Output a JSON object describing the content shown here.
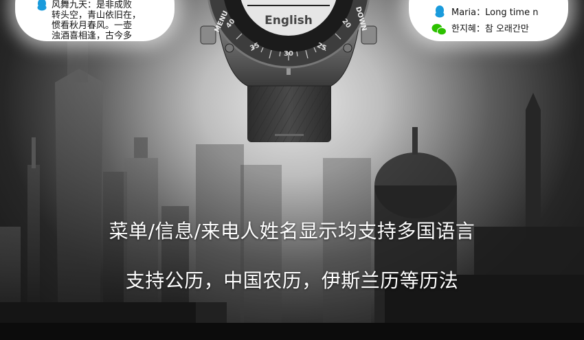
{
  "left_bubble": {
    "lines": [
      "风舞九天：是非成败",
      "转头空，青山依旧在，",
      "惯看秋月春风。一壶",
      "浊酒喜相逢，古今多"
    ]
  },
  "right_bubble": {
    "messages": [
      {
        "icon": "qq-penguin-icon",
        "text": "Maria：Long time n"
      },
      {
        "icon": "wechat-icon",
        "text": "한지혜：참 오래간만"
      }
    ]
  },
  "watch": {
    "screen_text": "English",
    "bezel_numbers": [
      "40",
      "35",
      "30",
      "25",
      "20"
    ],
    "left_button_label": "MENU",
    "right_button_label": "DOWN"
  },
  "captions": {
    "line1": "菜单/信息/来电人姓名显示均支持多国语言",
    "line2": "支持公历，中国农历，伊斯兰历等历法"
  },
  "colors": {
    "caption_text": "#ffffff",
    "wechat_green": "#2dc100",
    "qq_blue": "#1a9bdc"
  }
}
